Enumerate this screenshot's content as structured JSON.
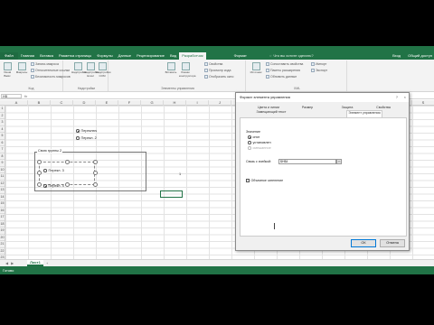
{
  "ribbon": {
    "tabs": [
      {
        "label": "Файл"
      },
      {
        "label": "Главная"
      },
      {
        "label": "Вставка"
      },
      {
        "label": "Разметка страницы"
      },
      {
        "label": "Формулы"
      },
      {
        "label": "Данные"
      },
      {
        "label": "Рецензирование"
      },
      {
        "label": "Вид"
      },
      {
        "label": "Разработчик"
      },
      {
        "label": "Формат"
      }
    ],
    "search_placeholder": "Что вы хотите сделать?",
    "sign_in": "Вход",
    "share": "Общий доступ",
    "groups": {
      "code_label": "Код",
      "addins_label": "Надстройки",
      "controls_label": "Элементы управления",
      "xml_label": "XML"
    },
    "code_big": "Visual Basic",
    "macros_big": "Макросы",
    "code_items": [
      "Запись макроса",
      "Относительные ссылки",
      "Безопасность макросов"
    ],
    "addins_items": [
      "Надстройки",
      "Надстройки Excel",
      "Надстройки COM"
    ],
    "controls_items": [
      "Вставить",
      "Режим конструктора",
      "Свойства",
      "Просмотр кода",
      "Отобразить окно"
    ],
    "xml_items": [
      "Источник",
      "Сопоставить свойства",
      "Пакеты расширения",
      "Обновить данные",
      "Импорт",
      "Экспорт"
    ]
  },
  "formula_bar": {
    "name_box": "H5",
    "fx": "fx"
  },
  "grid": {
    "columns": [
      "A",
      "B",
      "C",
      "D",
      "E",
      "F",
      "G",
      "H",
      "I",
      "J",
      "K",
      "L",
      "M",
      "N",
      "O",
      "P",
      "Q",
      "R",
      "S"
    ],
    "rows": [
      "1",
      "2",
      "3",
      "4",
      "5",
      "6",
      "7",
      "8",
      "9",
      "10",
      "11",
      "12",
      "13",
      "14",
      "15",
      "16",
      "17",
      "18",
      "19",
      "20",
      "21",
      "22",
      "23"
    ],
    "cell_value": "1"
  },
  "sheet": {
    "radio_top_1": "Переключ",
    "radio_top_2": "Перекл. 2",
    "group_title": "Свою группы 2",
    "radio_in_1": "Перекл. 3",
    "radio_in_2": "Перекл. 4"
  },
  "sheet_tabs": {
    "active": "Лист1",
    "add": "+"
  },
  "status": {
    "text": "Готово"
  },
  "dialog": {
    "title": "Формат элемента управления",
    "help": "?",
    "close": "×",
    "tabs": [
      "Цвета и линии",
      "Размер",
      "Защита",
      "Свойства",
      "Замещающий текст",
      "Элемент управления"
    ],
    "values_label": "Значение",
    "opt_checked": "снят",
    "opt_unchecked": "установлен",
    "opt_mixed": "смешанное",
    "link_label": "Связь с ячейкой:",
    "link_value": "$H$4",
    "shading_label": "Объемное затенение",
    "ok": "ОК",
    "cancel": "Отмена"
  }
}
